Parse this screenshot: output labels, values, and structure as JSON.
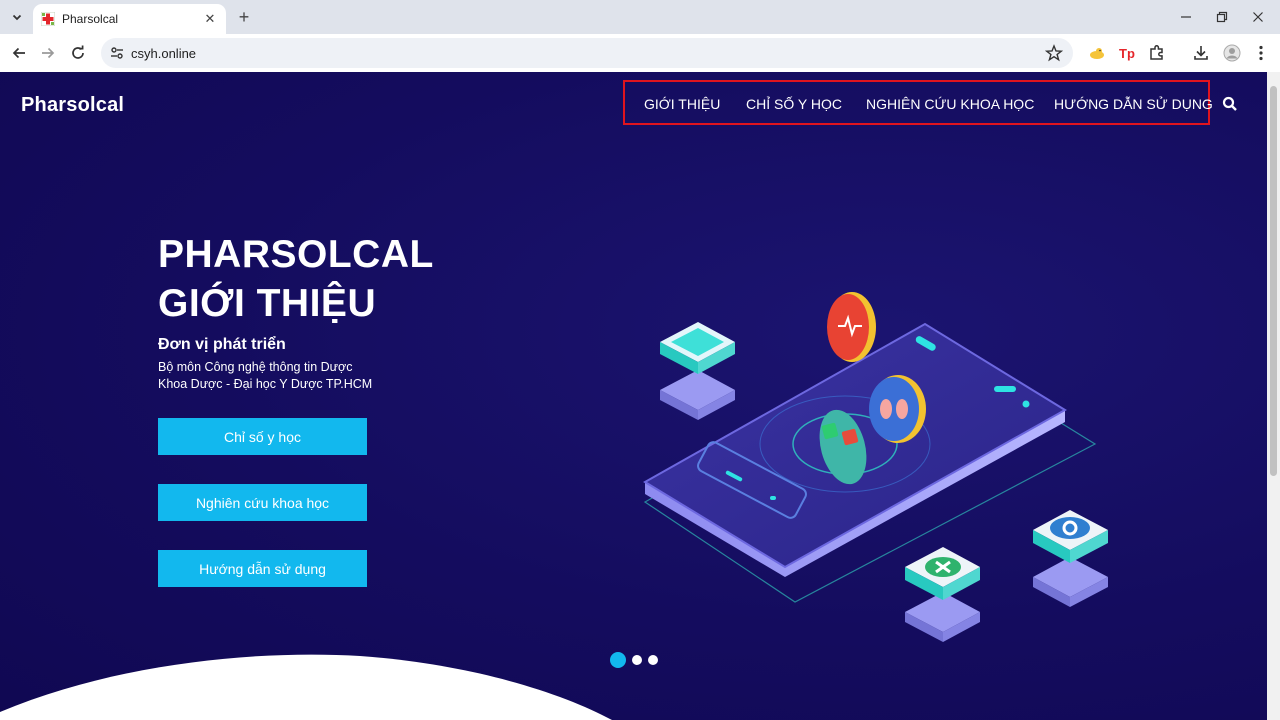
{
  "browser": {
    "tab_title": "Pharsolcal",
    "url": "csyh.online"
  },
  "site": {
    "logo": "Pharsolcal",
    "nav": [
      "GIỚI THIỆU",
      "CHỈ SỐ Y HỌC",
      "NGHIÊN CỨU KHOA HỌC",
      "HƯỚNG DẪN SỬ DỤNG"
    ]
  },
  "hero": {
    "title_line1": "PHARSOLCAL",
    "title_line2": "GIỚI THIỆU",
    "dev_heading": "Đơn vị phát triển",
    "dev_line1": "Bộ môn Công nghệ thông tin Dược",
    "dev_line2": "Khoa Dược - Đại học Y Dược TP.HCM",
    "buttons": [
      "Chỉ số y học",
      "Nghiên cứu khoa học",
      "Hướng dẫn sử dụng"
    ]
  },
  "slider": {
    "count": 3,
    "active_index": 1
  },
  "colors": {
    "hero_bg": "#140c5e",
    "button": "#12b8ee",
    "nav_highlight": "#e0141e",
    "dot_active": "#12b8ee"
  }
}
